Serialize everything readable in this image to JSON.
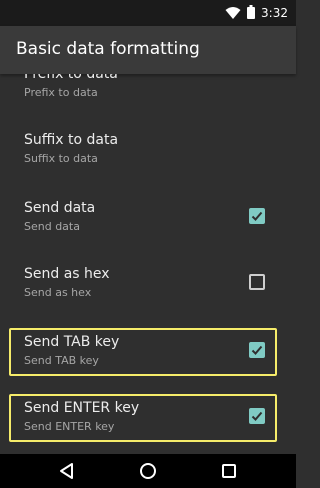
{
  "status_bar": {
    "time": "3:32"
  },
  "app_bar": {
    "title": "Basic data formatting"
  },
  "settings": {
    "prefix": {
      "title": "Prefix to data",
      "subtitle": "Prefix to data"
    },
    "suffix": {
      "title": "Suffix to data",
      "subtitle": "Suffix to data"
    },
    "send_data": {
      "title": "Send data",
      "subtitle": "Send data",
      "checked": true
    },
    "send_hex": {
      "title": "Send as hex",
      "subtitle": "Send as hex",
      "checked": false
    },
    "send_tab": {
      "title": "Send TAB key",
      "subtitle": "Send TAB key",
      "checked": true
    },
    "send_enter": {
      "title": "Send ENTER key",
      "subtitle": "Send ENTER key",
      "checked": true
    }
  },
  "colors": {
    "accent": "#80cbc4",
    "highlight": "#f6ec6a",
    "background": "#2f2f2f"
  },
  "icons": {
    "wifi": "wifi-icon",
    "battery": "battery-icon",
    "back": "back-icon",
    "home": "home-icon",
    "recents": "recents-icon",
    "check": "check-icon"
  }
}
